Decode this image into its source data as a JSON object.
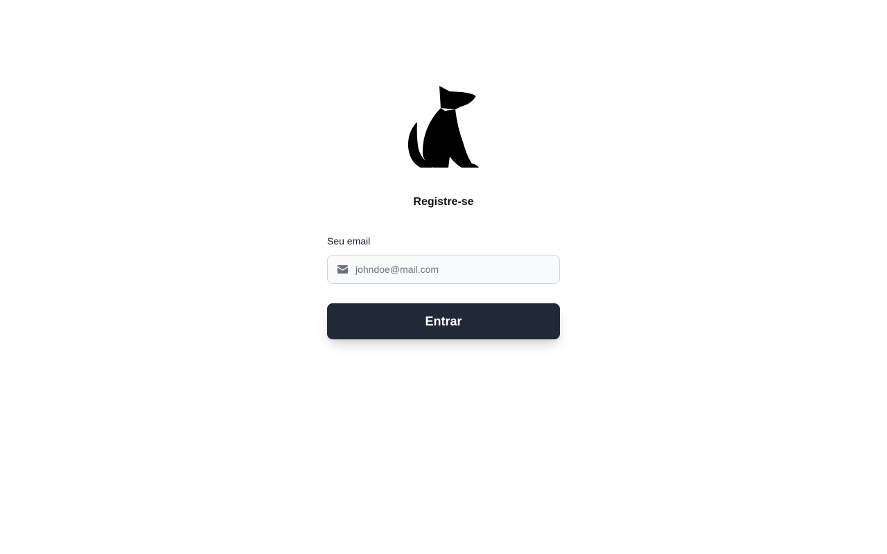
{
  "logo": {
    "icon": "sitting-dog-icon"
  },
  "page": {
    "title": "Registre-se"
  },
  "form": {
    "email_label": "Seu email",
    "email_placeholder": "johndoe@mail.com",
    "email_value": "",
    "email_icon": "envelope-icon",
    "submit_label": "Entrar"
  },
  "colors": {
    "button_bg": "#1f2937",
    "input_bg": "#f9fafb",
    "input_border": "#d1d5db",
    "placeholder": "#6b7280",
    "logo": "#000000"
  }
}
